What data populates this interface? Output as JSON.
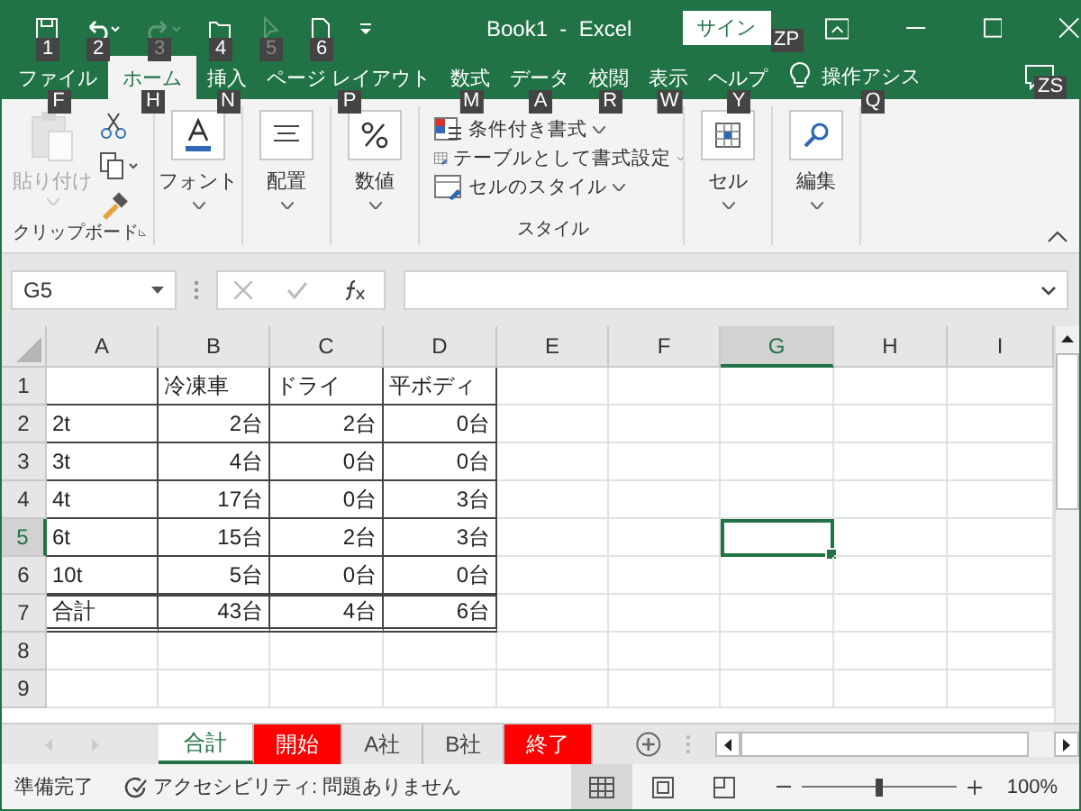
{
  "title_bar": {
    "quick_access": [
      {
        "kind": "save",
        "keytip": "1",
        "disabled": false
      },
      {
        "kind": "undo",
        "keytip": "2",
        "disabled": false
      },
      {
        "kind": "redo",
        "keytip": "3",
        "disabled": true
      },
      {
        "kind": "open",
        "keytip": "4",
        "disabled": false
      },
      {
        "kind": "touch",
        "keytip": "5",
        "disabled": true
      },
      {
        "kind": "new",
        "keytip": "6",
        "disabled": false
      }
    ],
    "title": "Book1  -  Excel",
    "signin": "サイン",
    "signin_keytip": "ZP"
  },
  "tabs": [
    {
      "label": "ファイル",
      "keytip": "F",
      "selected": false
    },
    {
      "label": "ホーム",
      "keytip": "H",
      "selected": true
    },
    {
      "label": "挿入",
      "keytip": "N",
      "selected": false
    },
    {
      "label": "ページ レイアウト",
      "keytip": "P",
      "selected": false
    },
    {
      "label": "数式",
      "keytip": "M",
      "selected": false
    },
    {
      "label": "データ",
      "keytip": "A",
      "selected": false
    },
    {
      "label": "校閲",
      "keytip": "R",
      "selected": false
    },
    {
      "label": "表示",
      "keytip": "W",
      "selected": false
    },
    {
      "label": "ヘルプ",
      "keytip": "Y",
      "selected": false
    }
  ],
  "tell_me": {
    "label": "操作アシス",
    "keytip": "Q"
  },
  "comments_keytip": "ZS",
  "ribbon": {
    "clipboard": {
      "paste": "貼り付け",
      "paste_disabled": true,
      "label": "クリップボード"
    },
    "big_buttons": [
      {
        "kind": "font",
        "label": "フォント"
      },
      {
        "kind": "align",
        "label": "配置"
      },
      {
        "kind": "number",
        "label": "数値"
      }
    ],
    "styles": {
      "items": [
        {
          "kind": "conditional",
          "label": "条件付き書式"
        },
        {
          "kind": "table",
          "label": "テーブルとして書式設定"
        },
        {
          "kind": "cellstyle",
          "label": "セルのスタイル"
        }
      ],
      "label": "スタイル"
    },
    "end_buttons": [
      {
        "kind": "cells",
        "label": "セル"
      },
      {
        "kind": "edit",
        "label": "編集"
      }
    ]
  },
  "formula_bar": {
    "name_box": "G5"
  },
  "grid": {
    "columns": [
      {
        "label": "A",
        "selected": false
      },
      {
        "label": "B",
        "selected": false
      },
      {
        "label": "C",
        "selected": false
      },
      {
        "label": "D",
        "selected": false
      },
      {
        "label": "E",
        "selected": false
      },
      {
        "label": "F",
        "selected": false
      },
      {
        "label": "G",
        "selected": true
      },
      {
        "label": "H",
        "selected": false
      },
      {
        "label": "I",
        "selected": false
      }
    ],
    "rows": [
      {
        "header": "1",
        "kind": "head",
        "selected": false,
        "cells": [
          "",
          "冷凍車",
          "ドライ",
          "平ボディ"
        ]
      },
      {
        "header": "2",
        "kind": "data",
        "selected": false,
        "cells": [
          "2t",
          "2台",
          "2台",
          "0台"
        ]
      },
      {
        "header": "3",
        "kind": "data",
        "selected": false,
        "cells": [
          "3t",
          "4台",
          "0台",
          "0台"
        ]
      },
      {
        "header": "4",
        "kind": "data",
        "selected": false,
        "cells": [
          "4t",
          "17台",
          "0台",
          "3台"
        ]
      },
      {
        "header": "5",
        "kind": "data",
        "selected": true,
        "cells": [
          "6t",
          "15台",
          "2台",
          "3台"
        ]
      },
      {
        "header": "6",
        "kind": "data",
        "selected": false,
        "cells": [
          "10t",
          "5台",
          "0台",
          "0台"
        ]
      },
      {
        "header": "7",
        "kind": "total",
        "selected": false,
        "cells": [
          "合計",
          "43台",
          "4台",
          "6台"
        ]
      },
      {
        "header": "8",
        "kind": "empty",
        "selected": false,
        "cells": []
      },
      {
        "header": "9",
        "kind": "empty",
        "selected": false,
        "cells": []
      }
    ]
  },
  "sheet_tabs": [
    {
      "label": "合計",
      "selected": true
    },
    {
      "label": "開始",
      "selected": false,
      "color": "#ff0000"
    },
    {
      "label": "A社",
      "selected": false
    },
    {
      "label": "B社",
      "selected": false
    },
    {
      "label": "終了",
      "selected": false,
      "color": "#ff0000"
    }
  ],
  "status_bar": {
    "ready": "準備完了",
    "accessibility": "アクセシビリティ: 問題ありません",
    "zoom_slider": {
      "level": 0.5
    },
    "zoom": "100%"
  }
}
